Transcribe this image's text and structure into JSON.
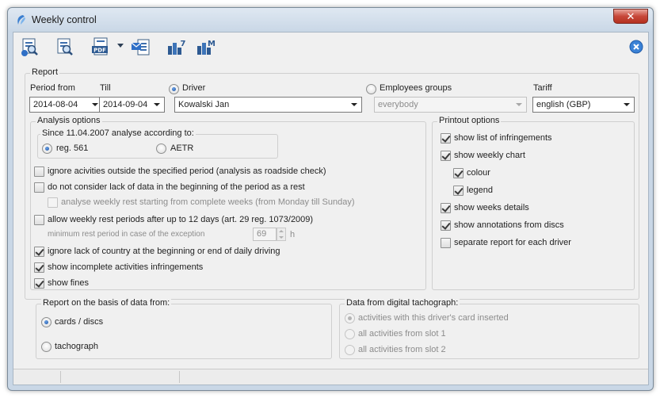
{
  "window": {
    "title": "Weekly control"
  },
  "toolbar": {
    "buttons": [
      {
        "name": "preview-icon"
      },
      {
        "name": "print-preview-icon"
      },
      {
        "name": "pdf-icon",
        "text": "PDF"
      },
      {
        "name": "email-icon"
      },
      {
        "name": "chart-7-icon",
        "text": "7"
      },
      {
        "name": "chart-m-icon",
        "text": "M"
      }
    ]
  },
  "report": {
    "legend": "Report",
    "period_from_label": "Period from",
    "period_from_value": "2014-08-04",
    "till_label": "Till",
    "till_value": "2014-09-04",
    "driver_label": "Driver",
    "driver_value": "Kowalski Jan",
    "employees_label": "Employees groups",
    "employees_value": "everybody",
    "tariff_label": "Tariff",
    "tariff_value": "english (GBP)"
  },
  "analysis": {
    "legend": "Analysis options",
    "since_legend": "Since 11.04.2007 analyse according to:",
    "reg561": "reg. 561",
    "aetr": "AETR",
    "opt_ignore_outside": "ignore acivities outside the specified period (analysis as roadside check)",
    "opt_no_lack": "do not consider lack of data in the beginning of the period as a rest",
    "opt_weekly_complete": "analyse weekly rest starting from complete weeks (from Monday till Sunday)",
    "opt_allow_weekly": "allow weekly rest periods after up to 12 days (art. 29 reg. 1073/2009)",
    "min_rest_label": "minimum rest period in case of the exception",
    "min_rest_value": "69",
    "min_rest_unit": "h",
    "opt_ignore_country": "ignore lack of country at the beginning or end of daily driving",
    "opt_incomplete": "show incomplete activities infringements",
    "opt_fines": "show fines"
  },
  "printout": {
    "legend": "Printout options",
    "list_infringements": "show list of infringements",
    "weekly_chart": "show weekly chart",
    "colour": "colour",
    "legend_opt": "legend",
    "weeks_details": "show weeks details",
    "annotations": "show annotations from discs",
    "separate_report": "separate report for each driver"
  },
  "basis": {
    "legend": "Report on the basis of data from:",
    "cards": "cards / discs",
    "tachograph": "tachograph"
  },
  "digital": {
    "legend": "Data from digital tachograph:",
    "with_card": "activities with this driver's card inserted",
    "slot1": "all activities from slot 1",
    "slot2": "all activities from slot 2"
  }
}
